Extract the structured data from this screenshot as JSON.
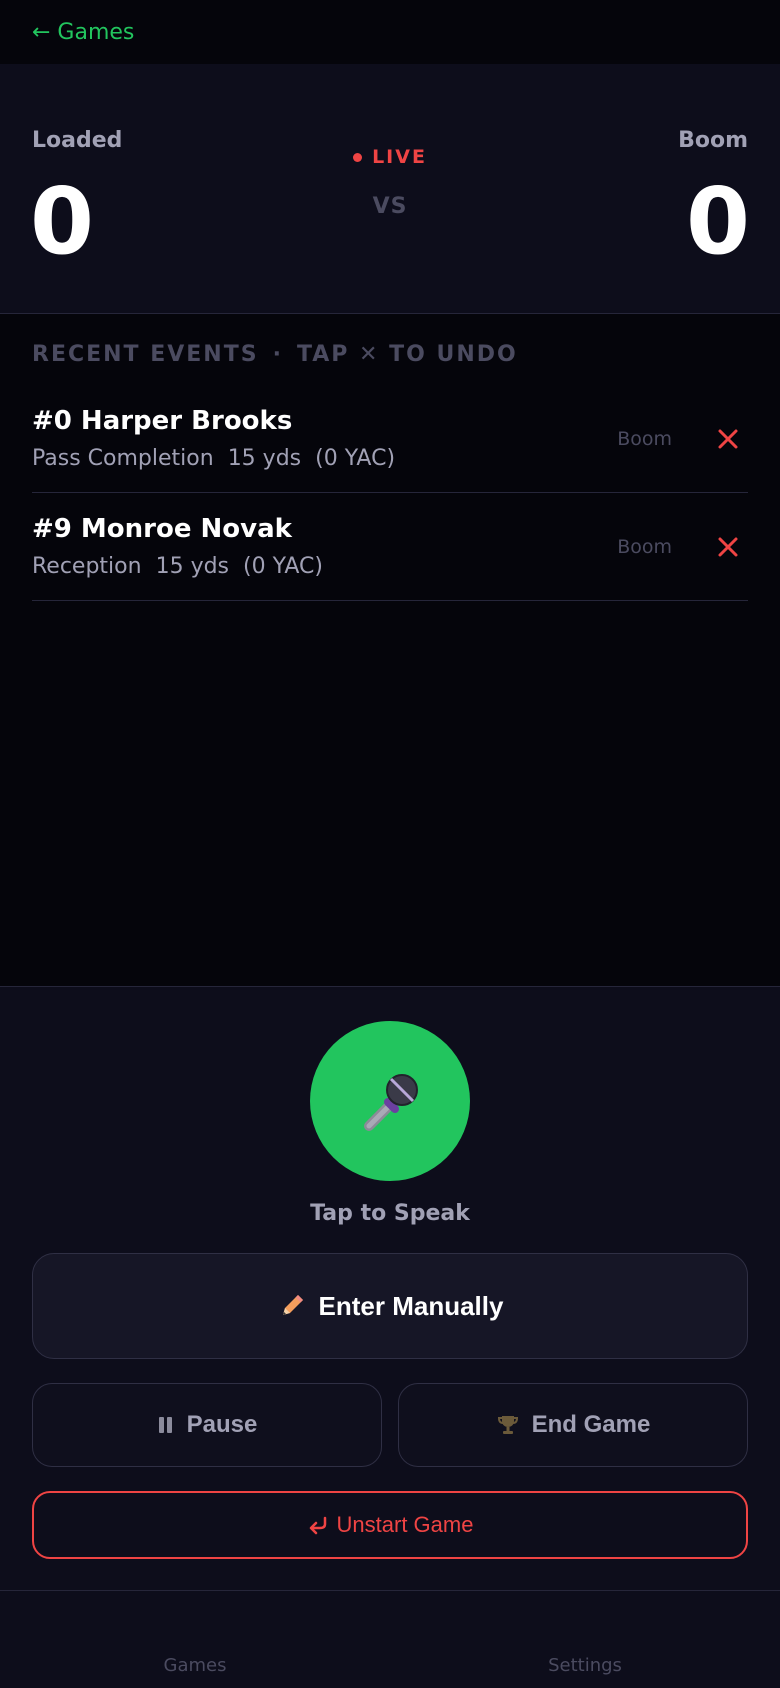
{
  "topbar": {
    "back_label": "← Games"
  },
  "scoreboard": {
    "status": "LIVE",
    "vs_label": "VS",
    "left_team": {
      "name": "Loaded",
      "score": "0"
    },
    "right_team": {
      "name": "Boom",
      "score": "0"
    }
  },
  "events": {
    "header_left": "RECENT EVENTS",
    "header_sep": "·",
    "header_right": "TAP ✕ TO UNDO",
    "items": [
      {
        "player": "#0 Harper Brooks",
        "type": "Pass Completion",
        "yards": "15 yds",
        "yac": "(0 YAC)",
        "team": "Boom"
      },
      {
        "player": "#9 Monroe Novak",
        "type": "Reception",
        "yards": "15 yds",
        "yac": "(0 YAC)",
        "team": "Boom"
      }
    ]
  },
  "controls": {
    "mic_caption": "Tap to Speak",
    "manual_label": "Enter Manually",
    "pause_label": "Pause",
    "end_label": "End Game",
    "unstart_label": "Unstart Game"
  },
  "tabs": [
    {
      "label": "Games"
    },
    {
      "label": "Settings"
    }
  ],
  "colors": {
    "accent": "#22c55e",
    "danger": "#ef4444",
    "bg": "#05050b",
    "panel": "#0d0d1b"
  }
}
